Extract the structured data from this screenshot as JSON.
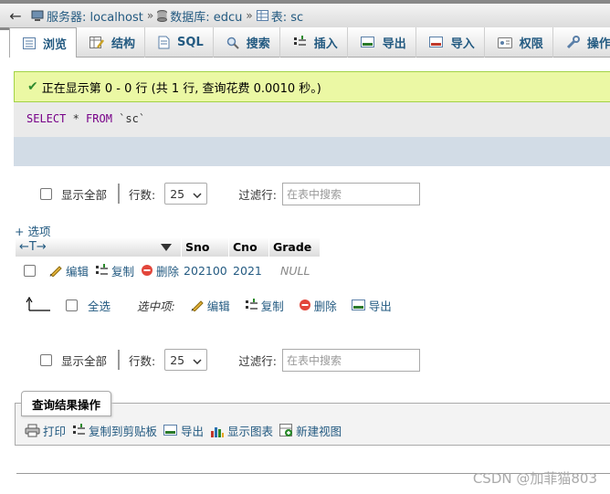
{
  "breadcrumb": {
    "back": "←",
    "server": "服务器: localhost",
    "database": "数据库: edcu",
    "table": "表: sc",
    "separator": "»"
  },
  "tabs": [
    {
      "label": "浏览",
      "icon": "browse-icon"
    },
    {
      "label": "结构",
      "icon": "structure-icon"
    },
    {
      "label": "SQL",
      "icon": "sql-icon"
    },
    {
      "label": "搜索",
      "icon": "search-icon"
    },
    {
      "label": "插入",
      "icon": "insert-icon"
    },
    {
      "label": "导出",
      "icon": "export-icon"
    },
    {
      "label": "导入",
      "icon": "import-icon"
    },
    {
      "label": "权限",
      "icon": "privileges-icon"
    },
    {
      "label": "操作",
      "icon": "operations-icon"
    }
  ],
  "notice": {
    "text": "正在显示第 0 - 0 行 (共 1 行, 查询花费 0.0010 秒。)"
  },
  "sql": {
    "select": "SELECT",
    "star": " * ",
    "from": "FROM",
    "table": " `sc`"
  },
  "nav": {
    "show_all": "显示全部",
    "rows_label": "行数:",
    "rows_value": "25",
    "filter_label": "过滤行:",
    "filter_placeholder": "在表中搜索"
  },
  "options_link": "+ 选项",
  "table": {
    "sort_arrows": "←T→",
    "columns": [
      "Sno",
      "Cno",
      "Grade"
    ],
    "rows": [
      {
        "edit": "编辑",
        "copy": "复制",
        "delete": "删除",
        "Sno": "202100",
        "Cno": "2021",
        "Grade": "NULL"
      }
    ]
  },
  "bulk": {
    "select_all": "全选",
    "selected_label": "选中项:",
    "edit": "编辑",
    "copy": "复制",
    "delete": "删除",
    "export": "导出"
  },
  "query_ops": {
    "title": "查询结果操作",
    "print": "打印",
    "copy_clipboard": "复制到剪贴板",
    "export": "导出",
    "show_chart": "显示图表",
    "create_view": "新建视图"
  },
  "watermark": "CSDN @加菲猫803",
  "colors": {
    "link": "#235a81",
    "success_bg": "#ebf8a4",
    "success_border": "#a2d246",
    "sql_keyword": "#770088"
  }
}
